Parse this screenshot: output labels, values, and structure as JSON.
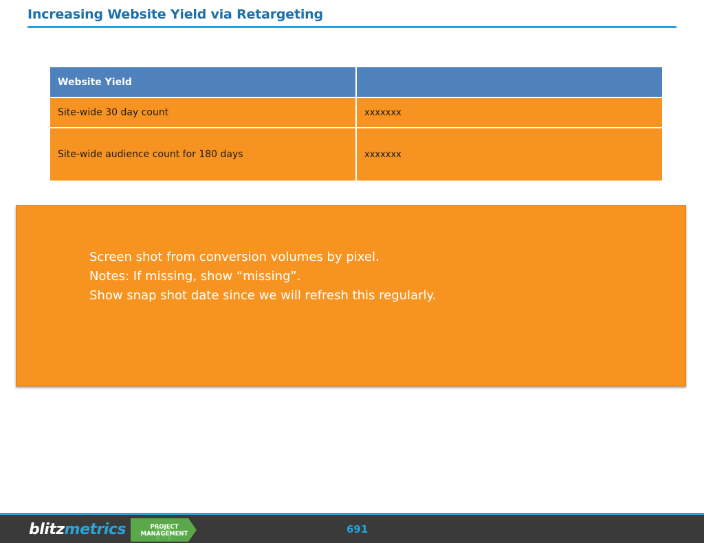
{
  "slide": {
    "title": "Increasing Website Yield via Retargeting"
  },
  "table": {
    "headers": [
      "Website Yield",
      ""
    ],
    "rows": [
      {
        "label": "Site-wide 30 day count",
        "value": "xxxxxxx"
      },
      {
        "label": "Site-wide audience count for 180 days",
        "value": "xxxxxxx"
      }
    ]
  },
  "note": {
    "lines": [
      "Screen shot from conversion volumes by pixel.",
      "Notes:  If missing, show “missing”.",
      "Show snap shot date since we will refresh this regularly."
    ]
  },
  "footer": {
    "logo_part1": "blitz",
    "logo_part2": "metrics",
    "badge_line1": "PROJECT",
    "badge_line2": "MANAGEMENT",
    "page_number": "691"
  },
  "colors": {
    "title": "#1f6fa8",
    "accent": "#2aa3db",
    "header_fill": "#4f81bd",
    "body_fill": "#f79421",
    "footer_bg": "#3a3a3a",
    "badge_green": "#5aa84a"
  }
}
